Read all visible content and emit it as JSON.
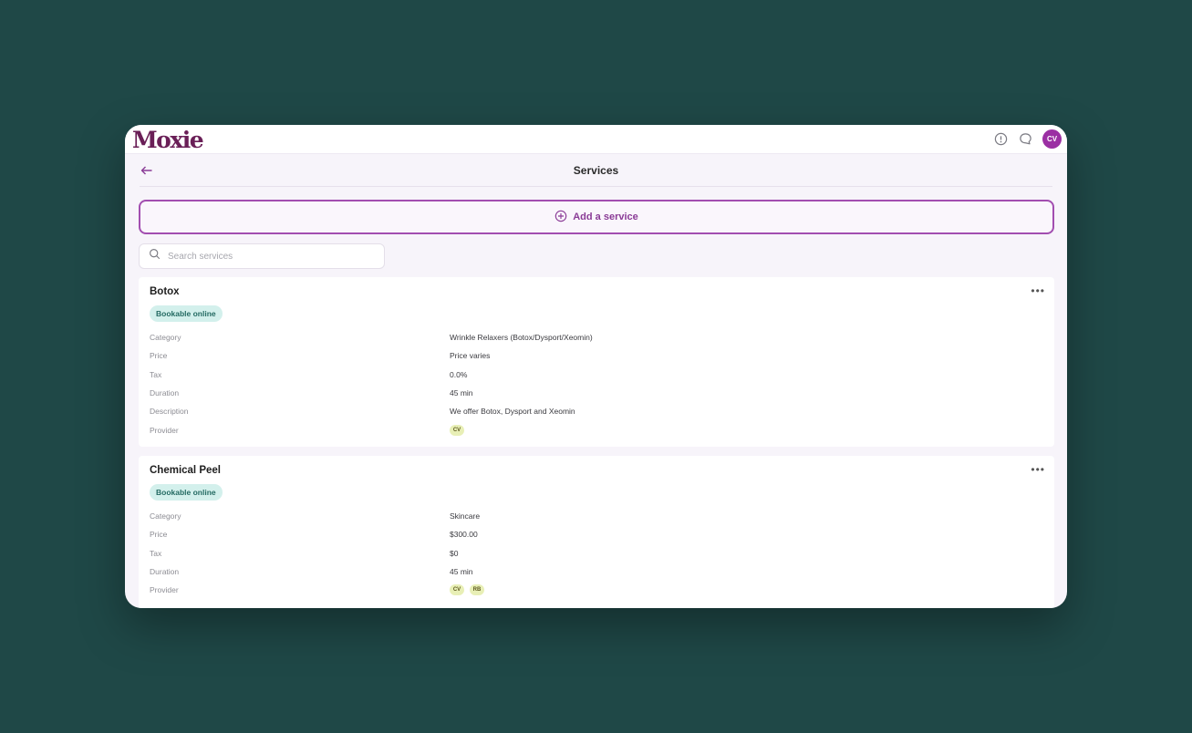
{
  "app": {
    "logo_text": "Moxie",
    "user_initials": "CV",
    "brand_color": "#8a3b96"
  },
  "header": {
    "title": "Services"
  },
  "actions": {
    "add_label": "Add a service"
  },
  "search": {
    "placeholder": "Search services",
    "value": ""
  },
  "services": [
    {
      "name": "Botox",
      "badge": "Bookable online",
      "fields": [
        {
          "label": "Category",
          "value": "Wrinkle Relaxers (Botox/Dysport/Xeomin)"
        },
        {
          "label": "Price",
          "value": "Price varies"
        },
        {
          "label": "Tax",
          "value": "0.0%"
        },
        {
          "label": "Duration",
          "value": "45 min"
        },
        {
          "label": "Description",
          "value": "We offer Botox, Dysport and Xeomin"
        },
        {
          "label": "Provider",
          "providers": [
            "CV"
          ]
        }
      ]
    },
    {
      "name": "Chemical Peel",
      "badge": "Bookable online",
      "fields": [
        {
          "label": "Category",
          "value": "Skincare"
        },
        {
          "label": "Price",
          "value": "$300.00"
        },
        {
          "label": "Tax",
          "value": "$0"
        },
        {
          "label": "Duration",
          "value": "45 min"
        },
        {
          "label": "Provider",
          "providers": [
            "CV",
            "RB"
          ]
        }
      ]
    }
  ],
  "icons": {
    "info": "info-icon",
    "chat": "chat-icon",
    "back": "arrow-left-icon",
    "add": "plus-circle-icon",
    "search": "search-icon",
    "more": "more-horizontal-icon"
  }
}
